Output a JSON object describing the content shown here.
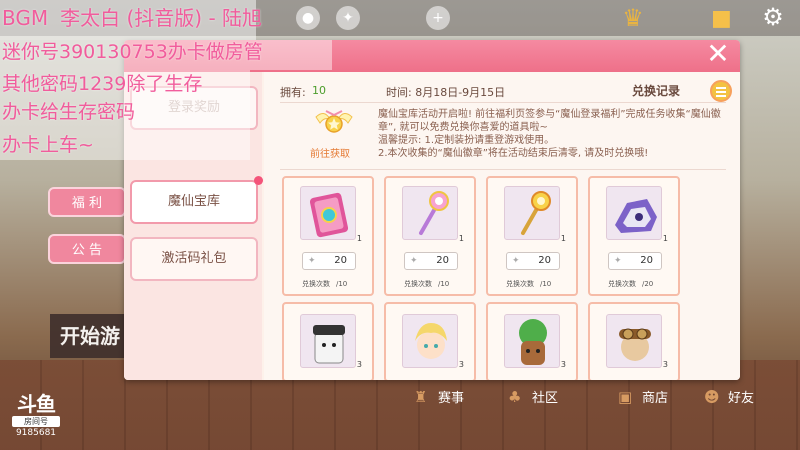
{
  "overlay": {
    "line1_bgm": "BGM",
    "line1_song": "李太白 (抖音版) - 陆旭",
    "line2": "迷你号390130753办卡做房管",
    "line3": "其他密码1239除了生存",
    "line4": "办卡给生存密码",
    "line5": "办卡上车~"
  },
  "left_menu": {
    "welfare": "福 利",
    "notice": "公 告",
    "start": "开始游"
  },
  "bottom_bar": {
    "events": "赛事",
    "community": "社区",
    "shop": "商店",
    "friends": "好友"
  },
  "logo": {
    "mark": "斗鱼",
    "sub": "房间号",
    "room_number": "9185681"
  },
  "dialog": {
    "close_label": "✕",
    "side": [
      {
        "label": "登录奖励"
      },
      {
        "label": "魔仙宝库"
      },
      {
        "label": "激活码礼包"
      }
    ],
    "owned_label": "拥有:",
    "owned_value": "10",
    "time_label": "时间: 8月18日-9月15日",
    "record_label": "兑换记录",
    "description": [
      "魔仙宝库活动开启啦! 前往福利页签参与“魔仙登录福利”完成任务收集“魔仙徽章”, 就可以免费兑换你喜爱的道具啦~",
      "温馨提示: 1.定制装扮请重登游戏使用。",
      "2.本次收集的“魔仙徽章”将在活动结束后清零, 请及时兑换哦!"
    ],
    "goto_label": "前往获取",
    "items": [
      {
        "qty": "1",
        "price": "20",
        "times_label": "兑换次数",
        "times_value": "/10"
      },
      {
        "qty": "1",
        "price": "20",
        "times_label": "兑换次数",
        "times_value": "/10"
      },
      {
        "qty": "1",
        "price": "20",
        "times_label": "兑换次数",
        "times_value": "/10"
      },
      {
        "qty": "1",
        "price": "20",
        "times_label": "兑换次数",
        "times_value": "/20"
      },
      {
        "qty": "3"
      },
      {
        "qty": "3"
      },
      {
        "qty": "3"
      },
      {
        "qty": "3"
      }
    ]
  },
  "colors": {
    "header_pink": "#ee7089",
    "overlay_text": "#f15c9c",
    "owned_green": "#4c9d2c",
    "goto_orange": "#e57a34"
  }
}
